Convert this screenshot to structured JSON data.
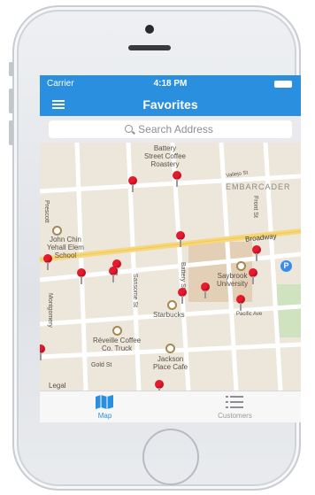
{
  "status_bar": {
    "carrier": "Carrier",
    "time": "4:18 PM"
  },
  "nav": {
    "title": "Favorites",
    "menu_icon": "hamburger-menu-icon"
  },
  "search": {
    "placeholder": "Search Address"
  },
  "map": {
    "labels": {
      "battery_coffee": "Battery\nStreet Coffee\nRoastery",
      "embarcadero": "EMBARCADER",
      "vallejo": "Vallejo St",
      "john_chin": "John Chin\nYehall Elem\nSchool",
      "broadway": "Broadway",
      "saybrook": "Saybrook\nUniversity",
      "starbucks": "Starbucks",
      "reveille": "Réveille Coffee\nCo. Truck",
      "jackson": "Jackson\nPlace Cafe",
      "pacific": "Pacific Ave",
      "sansome": "Sansome St",
      "battery_st": "Battery St",
      "front": "Front St",
      "gold": "Gold St",
      "legal": "Legal",
      "prescott": "Prescott",
      "montgomery": "Montgomery"
    },
    "pin_color": "#e8192c",
    "parking_label": "P"
  },
  "tabs": [
    {
      "label": "Map",
      "icon": "map-icon",
      "active": true
    },
    {
      "label": "Customers",
      "icon": "list-icon",
      "active": false
    }
  ],
  "colors": {
    "accent": "#2b8fe0",
    "pin": "#e8192c",
    "map_bg": "#ece6db"
  }
}
